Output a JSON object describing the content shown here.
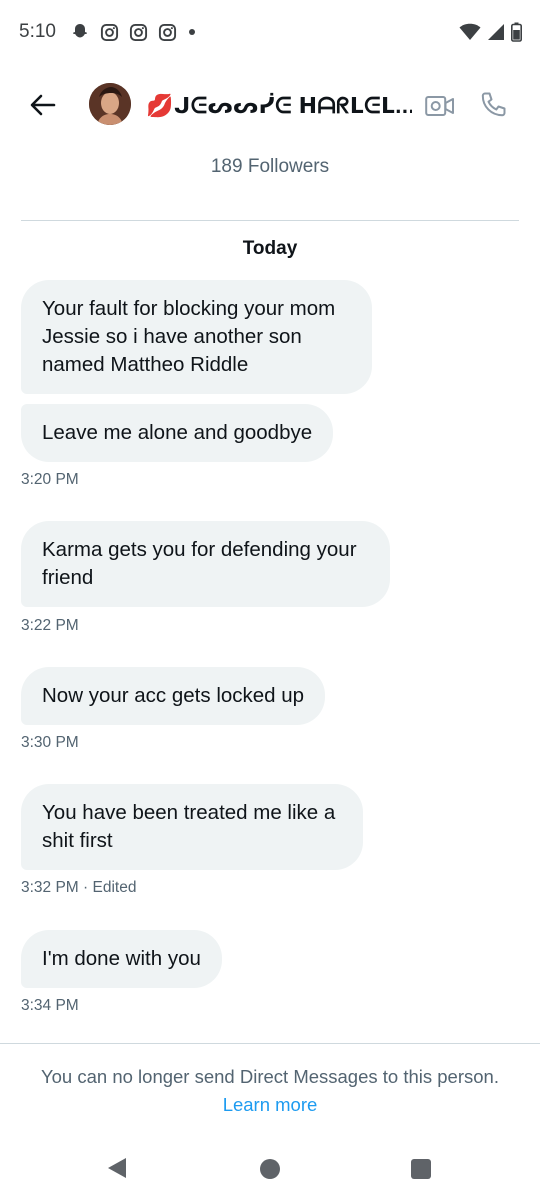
{
  "status_bar": {
    "time": "5:10",
    "left_icons": [
      "snapchat-icon",
      "instagram-icon",
      "instagram-icon",
      "instagram-icon",
      "dot-icon"
    ],
    "right_icons": [
      "wifi-icon",
      "signal-icon",
      "battery-icon"
    ]
  },
  "header": {
    "contact_name": "💋ᒍᕮᔕᔕᓰᕮ ᕼᗩᖇᒪᕮᒪ...",
    "followers": "189 Followers"
  },
  "conversation": {
    "day_label": "Today",
    "messages": [
      {
        "text": "Your fault for blocking your mom Jessie so i have another son named Mattheo Riddle"
      },
      {
        "text": "Leave me alone and goodbye",
        "time": "3:20 PM"
      },
      {
        "text": "Karma gets you for defending your friend",
        "time": "3:22 PM"
      },
      {
        "text": "Now your acc gets locked up",
        "time": "3:30 PM"
      },
      {
        "text": "You have been treated me like a shit first",
        "time": "3:32 PM · Edited"
      },
      {
        "text": "I'm done with you",
        "time": "3:34 PM"
      }
    ]
  },
  "footer": {
    "notice": "You can no longer send Direct Messages to this person.",
    "learn_more": "Learn more"
  },
  "colors": {
    "bubble": "#eff3f4",
    "secondary_text": "#536471",
    "link": "#1d9bf0",
    "divider": "#cfd9de"
  }
}
